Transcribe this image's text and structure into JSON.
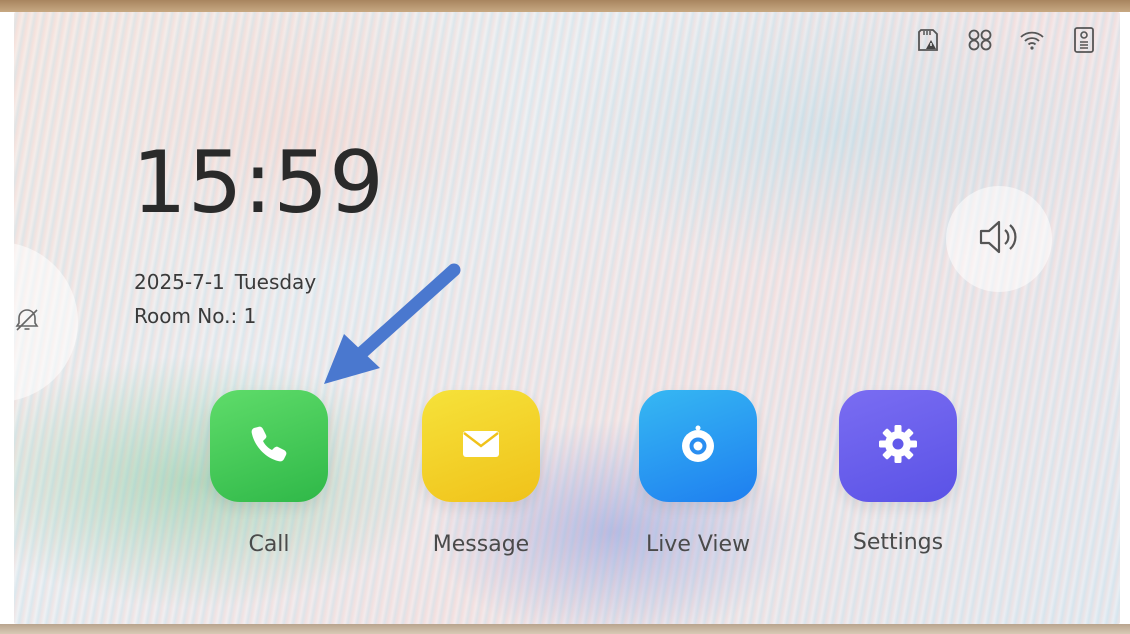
{
  "status_bar": {
    "icons": [
      "sd-card-warning-icon",
      "network-link-icon",
      "wifi-icon",
      "door-station-icon"
    ]
  },
  "clock": {
    "time": "15:59",
    "date": "2025-7-1",
    "weekday": "Tuesday",
    "room": "Room No.: 1"
  },
  "side_tab": {
    "icon": "do-not-disturb-icon"
  },
  "volume": {
    "icon": "speaker-icon"
  },
  "annotation": {
    "arrow_color": "#4a78cf",
    "points_to": "Call"
  },
  "apps": [
    {
      "label": "Call",
      "icon": "phone-icon",
      "color": "#3fc557"
    },
    {
      "label": "Message",
      "icon": "envelope-icon",
      "color": "#f2d22a"
    },
    {
      "label": "Live View",
      "icon": "camera-icon",
      "color": "#2a9cf2"
    },
    {
      "label": "Settings",
      "icon": "gear-icon",
      "color": "#6a60ec"
    }
  ]
}
